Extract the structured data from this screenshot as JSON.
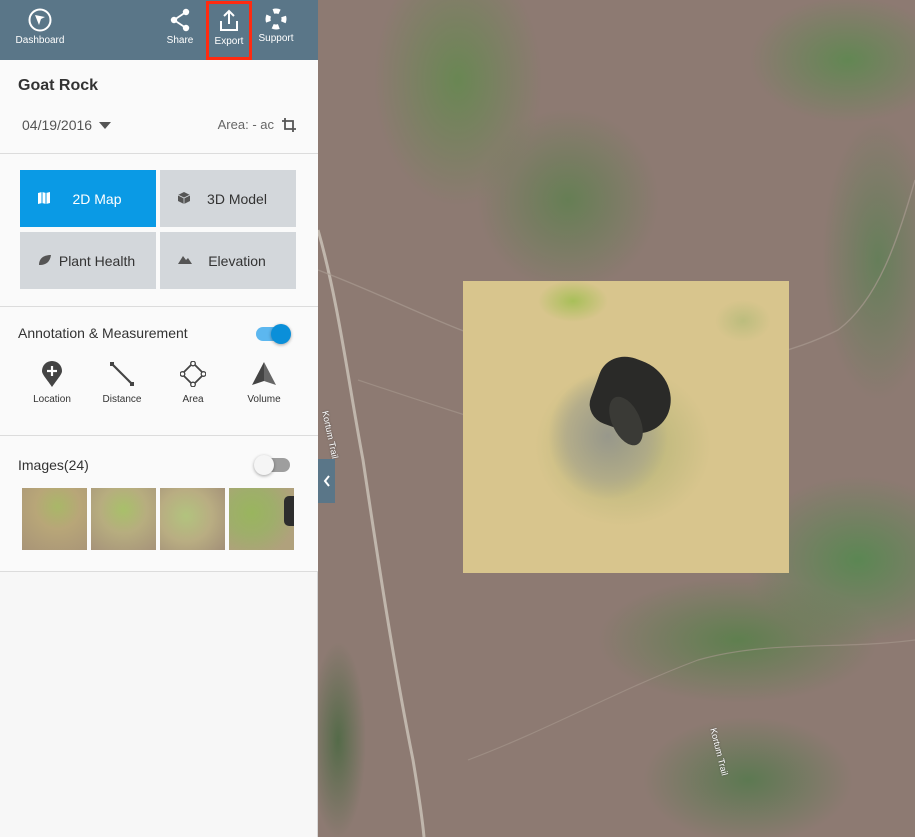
{
  "topbar": {
    "dashboard_label": "Dashboard",
    "share_label": "Share",
    "export_label": "Export",
    "support_label": "Support",
    "bg_color": "#5a7688",
    "highlight_color": "#ff2a10"
  },
  "project": {
    "title": "Goat Rock",
    "date": "04/19/2016",
    "area_label": "Area: - ac"
  },
  "views": {
    "active_color": "#0a9ae5",
    "items": [
      {
        "label": "2D Map",
        "icon": "map-icon",
        "active": true
      },
      {
        "label": "3D Model",
        "icon": "cube-icon",
        "active": false
      },
      {
        "label": "Plant Health",
        "icon": "leaf-icon",
        "active": false
      },
      {
        "label": "Elevation",
        "icon": "mountain-icon",
        "active": false
      }
    ]
  },
  "annotation": {
    "title": "Annotation & Measurement",
    "toggle_on": true,
    "tools": [
      {
        "label": "Location",
        "icon": "location-pin-plus-icon"
      },
      {
        "label": "Distance",
        "icon": "distance-line-icon"
      },
      {
        "label": "Area",
        "icon": "area-polygon-icon"
      },
      {
        "label": "Volume",
        "icon": "volume-pyramid-icon"
      }
    ]
  },
  "images": {
    "title": "Images(24)",
    "toggle_on": false
  },
  "map": {
    "trail_label_1": "Kortum Trail",
    "trail_label_2": "Kortum Trail"
  }
}
